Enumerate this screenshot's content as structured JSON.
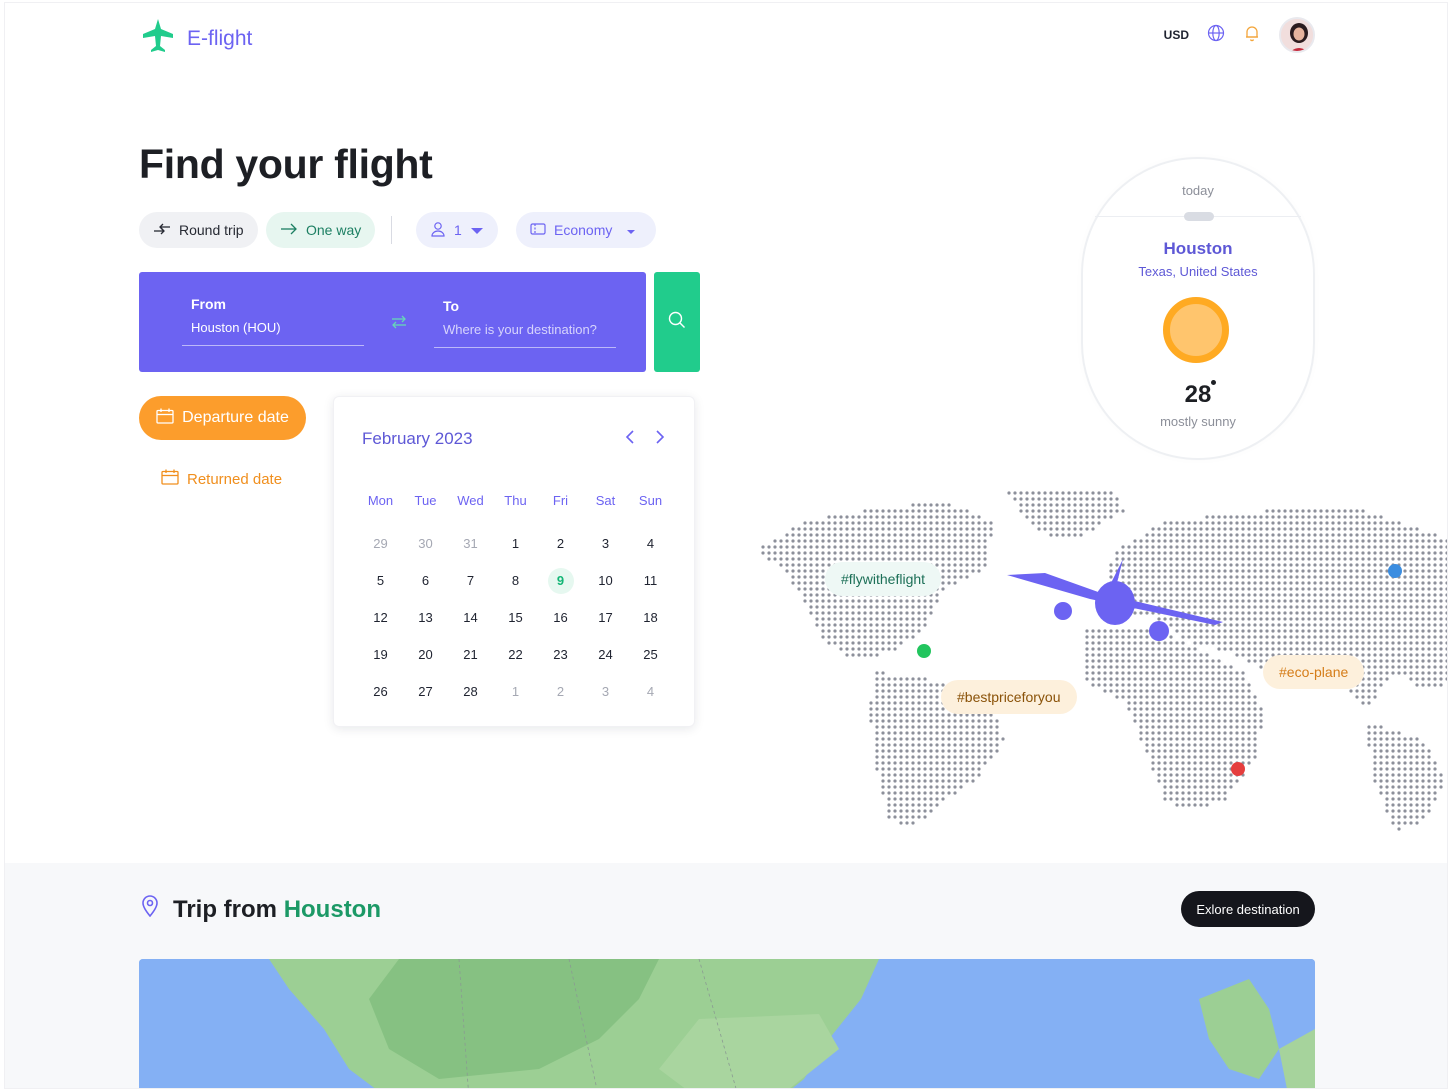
{
  "app": {
    "name": "E-flight"
  },
  "header": {
    "currency": "USD"
  },
  "hero": {
    "title": "Find your flight"
  },
  "trip_options": {
    "round_trip": "Round trip",
    "one_way": "One way",
    "passengers": "1",
    "cabin_class": "Economy"
  },
  "search": {
    "from_label": "From",
    "from_value": "Houston (HOU)",
    "to_label": "To",
    "to_placeholder": "Where is your destination?"
  },
  "dates": {
    "departure_label": "Departure date",
    "return_label": "Returned date"
  },
  "calendar": {
    "month": "February 2023",
    "weekdays": [
      "Mon",
      "Tue",
      "Wed",
      "Thu",
      "Fri",
      "Sat",
      "Sun"
    ],
    "weeks": [
      [
        {
          "d": "29",
          "m": true
        },
        {
          "d": "30",
          "m": true
        },
        {
          "d": "31",
          "m": true
        },
        {
          "d": "1"
        },
        {
          "d": "2"
        },
        {
          "d": "3"
        },
        {
          "d": "4"
        }
      ],
      [
        {
          "d": "5"
        },
        {
          "d": "6"
        },
        {
          "d": "7"
        },
        {
          "d": "8"
        },
        {
          "d": "9",
          "today": true
        },
        {
          "d": "10"
        },
        {
          "d": "11"
        }
      ],
      [
        {
          "d": "12"
        },
        {
          "d": "13"
        },
        {
          "d": "14"
        },
        {
          "d": "15"
        },
        {
          "d": "16"
        },
        {
          "d": "17"
        },
        {
          "d": "18"
        }
      ],
      [
        {
          "d": "19"
        },
        {
          "d": "20"
        },
        {
          "d": "21"
        },
        {
          "d": "22"
        },
        {
          "d": "23"
        },
        {
          "d": "24"
        },
        {
          "d": "25"
        }
      ],
      [
        {
          "d": "26"
        },
        {
          "d": "27"
        },
        {
          "d": "28"
        },
        {
          "d": "1",
          "m": true
        },
        {
          "d": "2",
          "m": true
        },
        {
          "d": "3",
          "m": true
        },
        {
          "d": "4",
          "m": true
        }
      ]
    ]
  },
  "weather": {
    "day": "today",
    "city": "Houston",
    "region": "Texas, United States",
    "temperature": "28",
    "condition": "mostly sunny"
  },
  "tags": {
    "fly": "#flywitheflight",
    "best_price": "#bestpriceforyou",
    "eco": "#eco-plane"
  },
  "trip_section": {
    "title_prefix": "Trip from",
    "city": "Houston",
    "explore_button": "Exlore destination"
  },
  "colors": {
    "brand": "#6c63f2",
    "accent_green": "#21cc8c",
    "accent_orange": "#fc9d2c",
    "dark": "#15161c"
  }
}
